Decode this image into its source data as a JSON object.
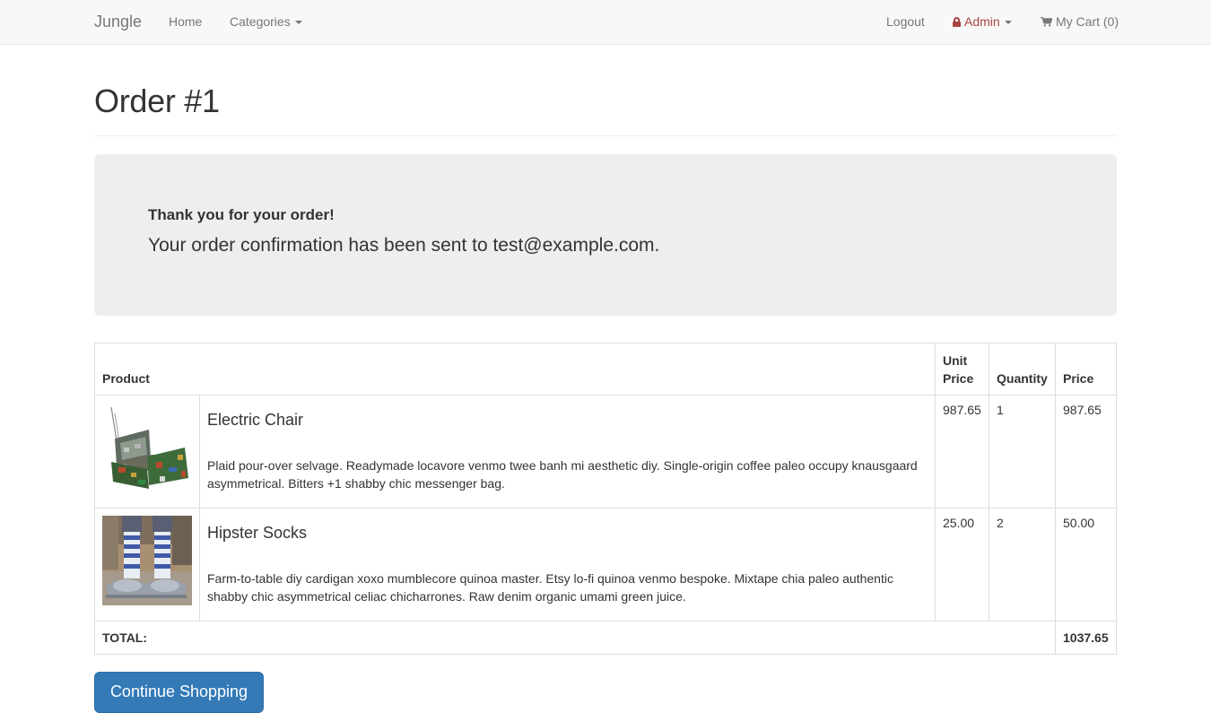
{
  "navbar": {
    "brand": "Jungle",
    "home": "Home",
    "categories": "Categories",
    "logout": "Logout",
    "admin": "Admin",
    "cart": "My Cart (0)"
  },
  "page": {
    "title": "Order #1"
  },
  "confirmation": {
    "heading": "Thank you for your order!",
    "message": "Your order confirmation has been sent to test@example.com."
  },
  "table": {
    "headers": {
      "product": "Product",
      "unit_price_line1": "Unit",
      "unit_price_line2": "Price",
      "quantity": "Quantity",
      "price": "Price"
    },
    "items": [
      {
        "name": "Electric Chair",
        "description": "Plaid pour-over selvage. Readymade locavore venmo twee banh mi aesthetic diy. Single-origin coffee paleo occupy knausgaard asymmetrical. Bitters +1 shabby chic messenger bag.",
        "unit_price": "987.65",
        "quantity": "1",
        "price": "987.65"
      },
      {
        "name": "Hipster Socks",
        "description": "Farm-to-table diy cardigan xoxo mumblecore quinoa master. Etsy lo-fi quinoa venmo bespoke. Mixtape chia paleo authentic shabby chic asymmetrical celiac chicharrones. Raw denim organic umami green juice.",
        "unit_price": "25.00",
        "quantity": "2",
        "price": "50.00"
      }
    ],
    "total_label": "TOTAL:",
    "total_value": "1037.65"
  },
  "actions": {
    "continue": "Continue Shopping"
  },
  "colors": {
    "navbar_bg": "#f8f8f8",
    "admin": "#a94442",
    "primary": "#337ab7",
    "jumbotron_bg": "#eeeeee"
  }
}
